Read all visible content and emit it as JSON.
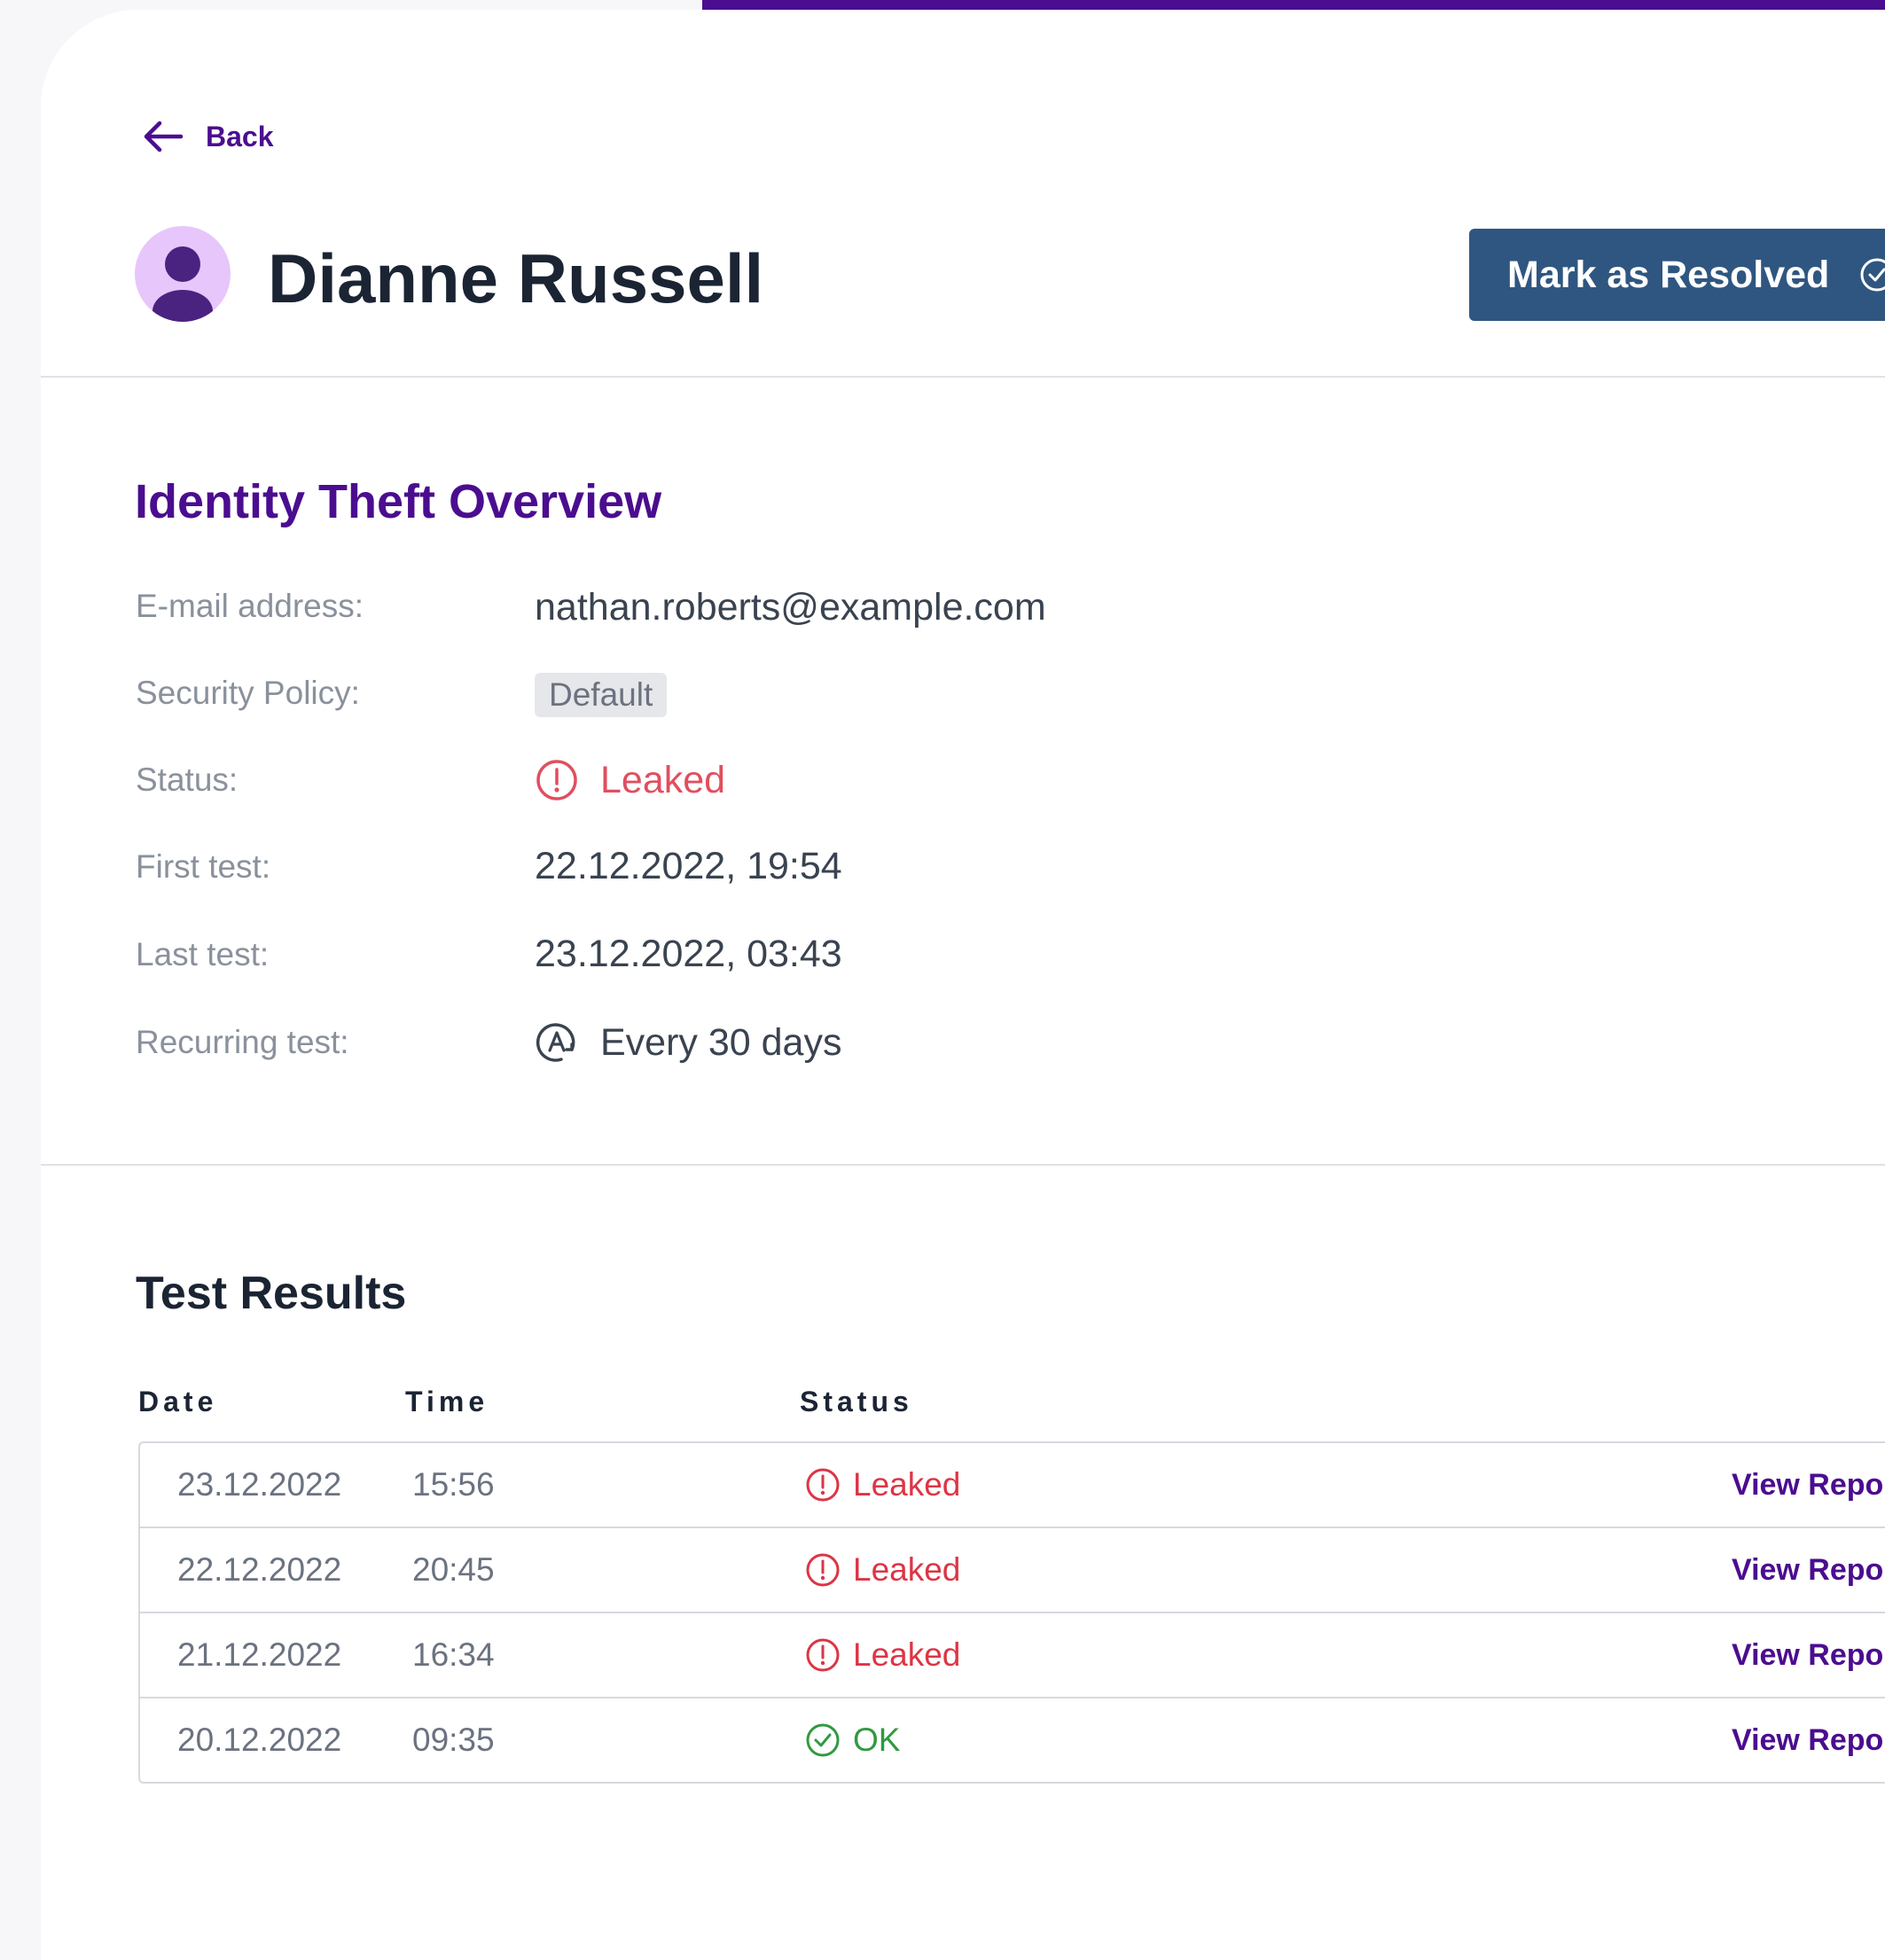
{
  "nav": {
    "back_label": "Back"
  },
  "header": {
    "name": "Dianne Russell",
    "resolve_label": "Mark as Resolved"
  },
  "overview": {
    "title": "Identity Theft Overview",
    "email_label": "E-mail address:",
    "email_value": "nathan.roberts@example.com",
    "policy_label": "Security Policy:",
    "policy_value": "Default",
    "status_label": "Status:",
    "status_value": "Leaked",
    "first_test_label": "First test:",
    "first_test_value": "22.12.2022, 19:54",
    "last_test_label": "Last test:",
    "last_test_value": "23.12.2022, 03:43",
    "recurring_label": "Recurring test:",
    "recurring_value": "Every 30 days"
  },
  "results": {
    "title": "Test Results",
    "columns": {
      "date": "Date",
      "time": "Time",
      "status": "Status"
    },
    "rows": [
      {
        "date": "23.12.2022",
        "time": "15:56",
        "status": "Leaked",
        "link": "View Report"
      },
      {
        "date": "22.12.2022",
        "time": "20:45",
        "status": "Leaked",
        "link": "View Report"
      },
      {
        "date": "21.12.2022",
        "time": "16:34",
        "status": "Leaked",
        "link": "View Report"
      },
      {
        "date": "20.12.2022",
        "time": "09:35",
        "status": "OK",
        "link": "View Report"
      }
    ]
  },
  "colors": {
    "accent": "#4b0d8f",
    "button": "#2f5680",
    "leaked": "#dc3545",
    "ok": "#2f9a3f"
  },
  "icons": [
    "arrow-left-icon",
    "user-avatar-icon",
    "check-circle-icon",
    "alert-circle-icon",
    "recurring-icon"
  ]
}
